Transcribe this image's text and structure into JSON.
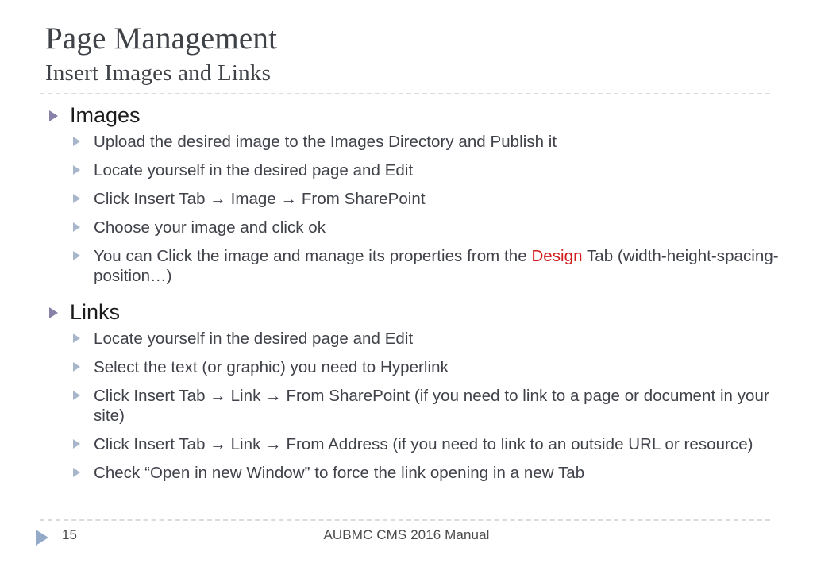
{
  "slide": {
    "title": "Page Management",
    "subtitle": "Insert Images and Links"
  },
  "sections": [
    {
      "heading": "Images",
      "bullets": [
        {
          "text": "Upload the desired image to the Images Directory and Publish it"
        },
        {
          "text": "Locate yourself in the desired page and Edit"
        },
        {
          "text": "Click Insert Tab → Image → From SharePoint"
        },
        {
          "text": "Choose your image and click ok"
        },
        {
          "parts": [
            {
              "text": "You can Click the image and manage its properties from the "
            },
            {
              "text": "Design",
              "color": "#d11b1b"
            },
            {
              "text": " Tab (width-height-spacing-position…)"
            }
          ]
        }
      ]
    },
    {
      "heading": "Links",
      "bullets": [
        {
          "text": "Locate yourself in the desired page and Edit"
        },
        {
          "text": "Select the text (or graphic) you need to Hyperlink"
        },
        {
          "text": "Click Insert Tab → Link → From SharePoint (if you need to link to a page or document in your site)"
        },
        {
          "text": "Click Insert Tab → Link → From Address (if you need to link to an outside URL or resource)"
        },
        {
          "text": "Check “Open in new Window” to force the link opening in a new Tab"
        }
      ]
    }
  ],
  "footer": {
    "page_number": "15",
    "center_text": "AUBMC CMS 2016 Manual"
  },
  "colors": {
    "title_text": "#3f4247",
    "body_text": "#40424a",
    "heading_text": "#1b1b1b",
    "accent_red": "#d11b1b",
    "bullet_level1": "#8882a8",
    "bullet_level2": "#a8b6cc",
    "footer_marker": "#93aac9",
    "divider": "#d9dbdd",
    "background": "#ffffff"
  }
}
